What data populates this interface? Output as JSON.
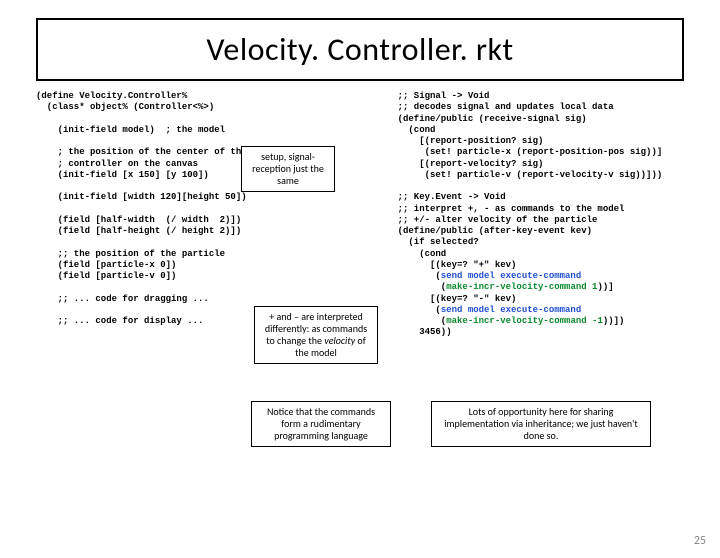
{
  "title": "Velocity. Controller. rkt",
  "pageNumber": "25",
  "codeLeft": {
    "l1": "(define Velocity.Controller%",
    "l2": "  (class* object% (Controller<%>)",
    "l3": "    (init-field model)  ; the model",
    "l4": "    ; the position of the center of the",
    "l5": "    ; controller on the canvas",
    "l6": "    (init-field [x 150] [y 100])",
    "l7": "    (init-field [width 120][height 50])",
    "l8": "    (field [half-width  (/ width  2)])",
    "l9": "    (field [half-height (/ height 2)])",
    "l10": "    ;; the position of the particle",
    "l11": "    (field [particle-x 0])",
    "l12": "    (field [particle-v 0])",
    "l13": "    ;; ... code for dragging ...",
    "l14": "    ;; ... code for display ..."
  },
  "codeRight": {
    "r1": "    ;; Signal -> Void",
    "r2": "    ;; decodes signal and updates local data",
    "r3": "    (define/public (receive-signal sig)",
    "r4": "      (cond",
    "r5": "        [(report-position? sig)",
    "r6": "         (set! particle-x (report-position-pos sig))]",
    "r7": "        [(report-velocity? sig)",
    "r8": "         (set! particle-v (report-velocity-v sig))]))",
    "r9": "    ;; Key.Event -> Void",
    "r10": "    ;; interpret +, - as commands to the model",
    "r11": "    ;; +/- alter velocity of the particle",
    "r12": "    (define/public (after-key-event kev)",
    "r13": "      (if selected?",
    "r14": "        (cond",
    "r15": "          [(key=? \"+\" kev)",
    "r16a": "           (",
    "r16b": "send model execute-command",
    "r17a": "            (",
    "r17b": "make-incr-velocity-command 1",
    "r17c": "))]",
    "r18": "          [(key=? \"-\" kev)",
    "r19a": "           (",
    "r19b": "send model execute-command",
    "r20a": "            (",
    "r20b": "make-incr-velocity-command -1",
    "r20c": "))])",
    "r21": "        3456))"
  },
  "callouts": {
    "c1": "setup, signal-reception just the same",
    "c2a": "+ and – are interpreted differently: as commands to change the ",
    "c2b": "velocity",
    "c2c": " of the model",
    "c3": "Notice that the commands form a rudimentary programming language",
    "c4": "Lots of opportunity here for sharing implementation via inheritance; we just haven't done so."
  }
}
